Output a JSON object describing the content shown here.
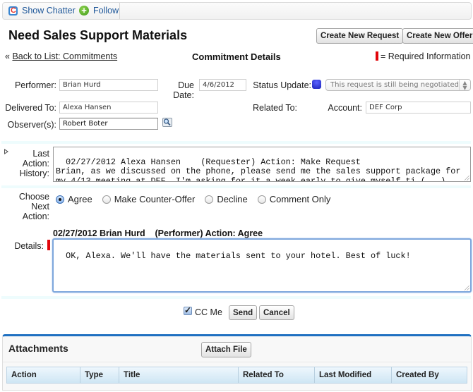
{
  "chatter_bar": {
    "show_chatter": "Show Chatter",
    "follow": "Follow",
    "chatter_icon_glyph": "C",
    "follow_icon_glyph": "+"
  },
  "page": {
    "title": "Need Sales Support Materials",
    "back_prefix": "«",
    "back_link": "Back to List: Commitments",
    "section_title": "Commitment Details",
    "required_legend": "= Required Information"
  },
  "buttons": {
    "create_request": "Create New Request",
    "create_offer": "Create New Offer",
    "send": "Send",
    "cancel": "Cancel",
    "attach_file": "Attach File"
  },
  "form": {
    "performer_label": "Performer:",
    "performer_value": "Brian Hurd",
    "due_date_label_1": "Due",
    "due_date_label_2": "Date:",
    "due_date_value": "4/6/2012",
    "status_label": "Status Update:",
    "status_value": "This request is still being negotiated",
    "status_color": "#2a32d6",
    "delivered_to_label": "Delivered To:",
    "delivered_to_value": "Alexa Hansen",
    "related_to_label": "Related To:",
    "account_label": "Account:",
    "account_value": "DEF Corp",
    "observers_label": "Observer(s):",
    "observers_value": "Robert Boter"
  },
  "history": {
    "label_1": "Last",
    "label_2": "Action:",
    "label_3": "History:",
    "text": "02/27/2012 Alexa Hansen    (Requester) Action: Make Request\nBrian, as we discussed on the phone, please send me the sales support package for\nmy 4/13 meeting at DEF. I'm asking for it a week early to give myself ti (...)"
  },
  "next_action": {
    "label_1": "Choose",
    "label_2": "Next",
    "label_3": "Action:",
    "options": [
      {
        "label": "Agree",
        "checked": true
      },
      {
        "label": "Make Counter-Offer",
        "checked": false
      },
      {
        "label": "Decline",
        "checked": false
      },
      {
        "label": "Comment Only",
        "checked": false
      }
    ]
  },
  "details": {
    "header": "02/27/2012 Brian Hurd    (Performer) Action: Agree",
    "label": "Details:",
    "text": "OK, Alexa. We'll have the materials sent to your hotel. Best of luck!"
  },
  "cc_me": {
    "label": "CC Me",
    "checked": true
  },
  "attachments": {
    "title": "Attachments",
    "columns": [
      "Action",
      "Type",
      "Title",
      "Related To",
      "Last Modified",
      "Created By"
    ]
  },
  "colors": {
    "link": "#1e5799",
    "required": "#e1050a",
    "section_accent": "#1f70c1"
  }
}
